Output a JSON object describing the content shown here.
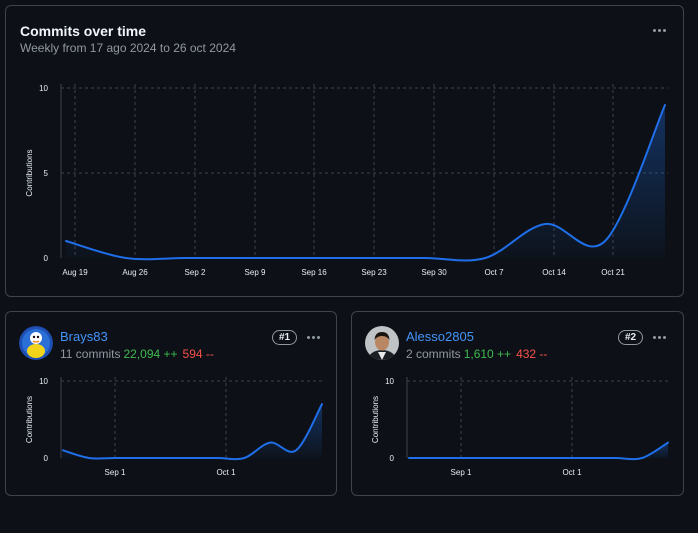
{
  "header": {
    "title": "Commits over time",
    "subtitle": "Weekly from 17 ago 2024 to 26 oct 2024"
  },
  "chart_data": [
    {
      "type": "area",
      "title": "Commits over time",
      "ylabel": "Contributions",
      "ylim": [
        0,
        10
      ],
      "yticks": [
        0,
        5,
        10
      ],
      "categories": [
        "Aug 19",
        "Aug 26",
        "Sep 2",
        "Sep 9",
        "Sep 16",
        "Sep 23",
        "Sep 30",
        "Oct 7",
        "Oct 14",
        "Oct 21"
      ],
      "x": [
        "Aug 18",
        "Aug 25",
        "Sep 1",
        "Sep 8",
        "Sep 15",
        "Sep 22",
        "Sep 29",
        "Oct 6",
        "Oct 13",
        "Oct 20",
        "Oct 26"
      ],
      "values": [
        1,
        0,
        0,
        0,
        0,
        0,
        0,
        0,
        2,
        1,
        9
      ],
      "grid": true,
      "color": "#1f6feb"
    },
    {
      "type": "area",
      "ylabel": "Contributions",
      "ylim": [
        0,
        10
      ],
      "yticks": [
        0,
        10
      ],
      "categories": [
        "Sep 1",
        "Oct 1"
      ],
      "values": [
        1,
        0,
        0,
        0,
        0,
        0,
        0,
        0,
        2,
        1,
        7
      ],
      "grid": true,
      "color": "#1f6feb"
    },
    {
      "type": "area",
      "ylabel": "Contributions",
      "ylim": [
        0,
        10
      ],
      "yticks": [
        0,
        10
      ],
      "categories": [
        "Sep 1",
        "Oct 1"
      ],
      "values": [
        0,
        0,
        0,
        0,
        0,
        0,
        0,
        0,
        0,
        0,
        2
      ],
      "grid": true,
      "color": "#1f6feb"
    }
  ],
  "contributors": [
    {
      "name": "Brays83",
      "commits": "11 commits",
      "additions": "22,094 ++",
      "deletions": "594 --",
      "rank": "#1"
    },
    {
      "name": "Alesso2805",
      "commits": "2 commits",
      "additions": "1,610 ++",
      "deletions": "432 --",
      "rank": "#2"
    }
  ],
  "icons": {
    "menu": "kebab-horizontal-icon"
  }
}
